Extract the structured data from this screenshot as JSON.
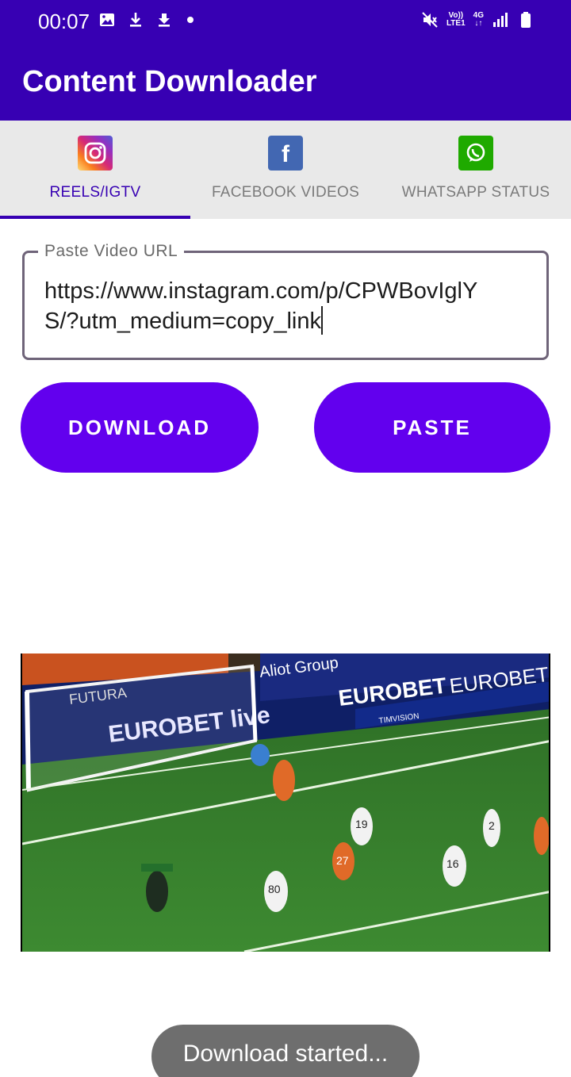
{
  "status_bar": {
    "time": "00:07",
    "left_icons": [
      "image-icon",
      "download-icon",
      "download-icon",
      "dot-icon"
    ],
    "network_label_top": "Vo))",
    "network_label_bottom": "LTE1",
    "network_type": "4G",
    "right_icons": [
      "mute-icon",
      "signal-icon",
      "battery-icon"
    ]
  },
  "app_bar": {
    "title": "Content Downloader",
    "color": "#3700b3"
  },
  "tabs": [
    {
      "label": "REELS/IGTV",
      "icon": "instagram-icon",
      "active": true
    },
    {
      "label": "FACEBOOK VIDEOS",
      "icon": "facebook-icon",
      "active": false
    },
    {
      "label": "WHATSAPP STATUS",
      "icon": "whatsapp-icon",
      "active": false
    }
  ],
  "url_field": {
    "label": "Paste Video URL",
    "value": "https://www.instagram.com/p/CPWBovIglYS/?utm_medium=copy_link"
  },
  "buttons": {
    "download": "DOWNLOAD",
    "paste": "PASTE",
    "color": "#6200ee"
  },
  "video_preview": {
    "banners": [
      "EUROBET live",
      "Aliot Group",
      "TIMVISION",
      "FUTURA"
    ],
    "player_numbers": [
      "19",
      "27",
      "80",
      "16",
      "2"
    ]
  },
  "toast": {
    "text": "Download started..."
  }
}
